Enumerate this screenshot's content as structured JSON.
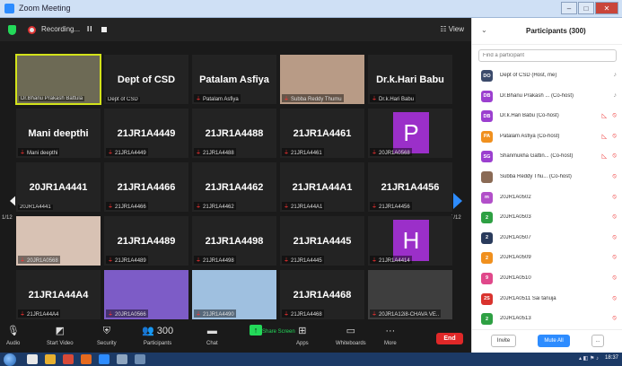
{
  "window": {
    "title": "Zoom Meeting"
  },
  "topbar": {
    "recording_label": "Recording...",
    "view_label": "View"
  },
  "pagination": {
    "left": "1/12",
    "right": "1/12"
  },
  "tiles": [
    {
      "name": "",
      "label": "Dr.Bhanu Prakash Battula",
      "type": "photo",
      "color": "#6d6a55",
      "active": true,
      "muted": false
    },
    {
      "name": "Dept of CSD",
      "label": "Dept of CSD",
      "type": "name",
      "muted": false
    },
    {
      "name": "Patalam Asfiya",
      "label": "Patalam Asfiya",
      "type": "name",
      "muted": true
    },
    {
      "name": "",
      "label": "Subba Reddy Thumu",
      "type": "photo",
      "color": "#b89b86",
      "muted": true
    },
    {
      "name": "Dr.k.Hari Babu",
      "label": "Dr.k.Hari Babu",
      "type": "name",
      "muted": true
    },
    {
      "name": "Mani deepthi",
      "label": "Mani deepthi",
      "type": "name",
      "muted": true
    },
    {
      "name": "21JR1A4449",
      "label": "21JR1A4449",
      "type": "name",
      "muted": true
    },
    {
      "name": "21JR1A4488",
      "label": "21JR1A4488",
      "type": "name",
      "muted": true
    },
    {
      "name": "21JR1A4461",
      "label": "21JR1A4461",
      "type": "name",
      "muted": true
    },
    {
      "name": "",
      "label": "20JR1A0568",
      "type": "avatar",
      "letter": "P",
      "color": "#9b2fc9",
      "muted": true
    },
    {
      "name": "20JR1A4441",
      "label": "20JR1A4441",
      "type": "name",
      "muted": false
    },
    {
      "name": "21JR1A4466",
      "label": "21JR1A4466",
      "type": "name",
      "muted": true
    },
    {
      "name": "21JR1A4462",
      "label": "21JR1A4462",
      "type": "name",
      "muted": true
    },
    {
      "name": "21JR1A44A1",
      "label": "21JR1A44A1",
      "type": "name",
      "muted": true
    },
    {
      "name": "21JR1A4456",
      "label": "21JR1A4456",
      "type": "name",
      "muted": true
    },
    {
      "name": "",
      "label": "20JR1A0568",
      "type": "photo",
      "color": "#d8c2b4",
      "muted": true
    },
    {
      "name": "21JR1A4489",
      "label": "21JR1A4489",
      "type": "name",
      "muted": true
    },
    {
      "name": "21JR1A4498",
      "label": "21JR1A4498",
      "type": "name",
      "muted": true
    },
    {
      "name": "21JR1A4445",
      "label": "21JR1A4445",
      "type": "name",
      "muted": true
    },
    {
      "name": "",
      "label": "21JR1A4414",
      "type": "avatar",
      "letter": "H",
      "color": "#9b2fc9",
      "muted": true
    },
    {
      "name": "21JR1A44A4",
      "label": "21JR1A44A4",
      "type": "name",
      "muted": true
    },
    {
      "name": "",
      "label": "20JR1A0566",
      "type": "photo",
      "color": "#7d5cc7",
      "muted": true
    },
    {
      "name": "",
      "label": "21JR1A4490",
      "type": "photo",
      "color": "#9fc0e0",
      "muted": true
    },
    {
      "name": "21JR1A4468",
      "label": "21JR1A4468",
      "type": "name",
      "muted": true
    },
    {
      "name": "",
      "label": "20JR1A12i8-CHAVA VE..",
      "type": "photo",
      "color": "#3e3e3e",
      "muted": true
    }
  ],
  "toolbar": {
    "items": [
      {
        "label": "Audio",
        "icon": "audio-icon",
        "glyph": "🎙"
      },
      {
        "label": "Start Video",
        "icon": "video-off-icon",
        "glyph": "◩"
      },
      {
        "label": "Security",
        "icon": "security-icon",
        "glyph": "⛨"
      },
      {
        "label": "Participants",
        "icon": "participants-icon",
        "glyph": "👥 300"
      },
      {
        "label": "Chat",
        "icon": "chat-icon",
        "glyph": "▬"
      },
      {
        "label": "Share Screen",
        "icon": "share-screen-icon",
        "glyph": "↑"
      },
      {
        "label": "Apps",
        "icon": "apps-icon",
        "glyph": "⊞"
      },
      {
        "label": "Whiteboards",
        "icon": "whiteboard-icon",
        "glyph": "▭"
      },
      {
        "label": "More",
        "icon": "more-icon",
        "glyph": "···"
      }
    ],
    "end_label": "End"
  },
  "panel": {
    "title": "Participants (300)",
    "search_placeholder": "Find a participant",
    "participants": [
      {
        "initials": "DO",
        "name": "Dept of CSD (Host, me)",
        "color": "#3b4a6b",
        "video_off": false,
        "mic_muted": false
      },
      {
        "initials": "DB",
        "name": "Dr.Bhanu Prakash ... (Co-host)",
        "color": "#9b3fcf",
        "video_off": false,
        "mic_muted": false
      },
      {
        "initials": "DB",
        "name": "Dr.k.Hari Babu (Co-host)",
        "color": "#9b3fcf",
        "video_off": true,
        "mic_muted": true
      },
      {
        "initials": "PA",
        "name": "Patalam Asfiya (Co-host)",
        "color": "#f0901e",
        "video_off": true,
        "mic_muted": true
      },
      {
        "initials": "SG",
        "name": "Shanmukha Gattin... (Co-host)",
        "color": "#9b3fcf",
        "video_off": true,
        "mic_muted": true
      },
      {
        "initials": "",
        "name": "Subba Reddy Thu... (Co-host)",
        "color": "#8a6a55",
        "video_off": false,
        "mic_muted": true
      },
      {
        "initials": "m",
        "name": "20JR1A0502",
        "color": "#b24fc9",
        "video_off": false,
        "mic_muted": true
      },
      {
        "initials": "2",
        "name": "20JR1A0503",
        "color": "#2ea043",
        "video_off": false,
        "mic_muted": true
      },
      {
        "initials": "2",
        "name": "20JR1A0507",
        "color": "#2a3b5c",
        "video_off": false,
        "mic_muted": true
      },
      {
        "initials": "2",
        "name": "20JR1A0509",
        "color": "#f0901e",
        "video_off": false,
        "mic_muted": true
      },
      {
        "initials": "9",
        "name": "20JR1A0510",
        "color": "#e0488a",
        "video_off": false,
        "mic_muted": true
      },
      {
        "initials": "2S",
        "name": "20JR1A0511 Sai tanuja",
        "color": "#d9332e",
        "video_off": false,
        "mic_muted": true
      },
      {
        "initials": "2",
        "name": "20JR1A0513",
        "color": "#2ea043",
        "video_off": false,
        "mic_muted": true
      }
    ],
    "invite_label": "Invite",
    "mute_all_label": "Mute All",
    "more_label": "..."
  },
  "taskbar": {
    "clock": "18:37"
  }
}
